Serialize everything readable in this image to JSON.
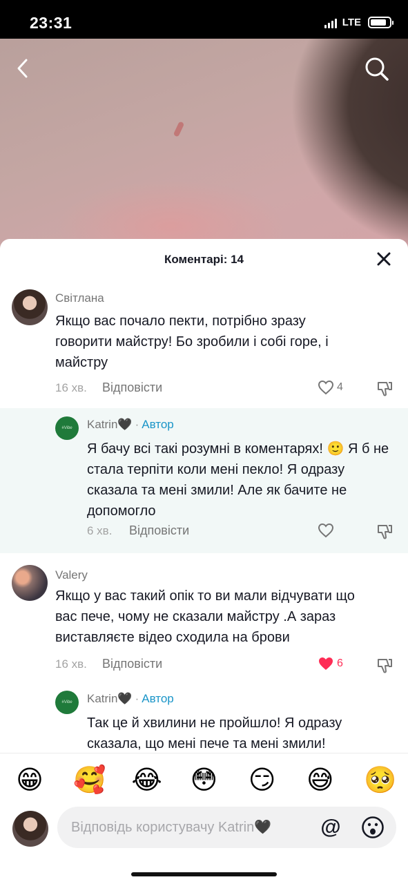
{
  "status_bar": {
    "time": "23:31",
    "network": "LTE",
    "icons": [
      "signal-icon",
      "battery-icon"
    ]
  },
  "video": {
    "nav": {
      "back_icon": "chevron-left-icon",
      "search_icon": "search-icon"
    }
  },
  "comments_sheet": {
    "title": "Коментарі: 14",
    "close_icon": "close-icon",
    "comments": [
      {
        "author": "Світлана",
        "text": "Якщо вас почало пекти, потрібно зразу говорити майстру! Бо зробили і собі горе, і майстру",
        "time": "16 хв.",
        "reply_label": "Відповісти",
        "likes": "4",
        "liked": false
      },
      {
        "author": "Katrin🖤",
        "badge": "Автор",
        "separator": "·",
        "text": "Я бачу всі такі розумні в коментарях! 🙂 Я б не стала терпіти коли мені пекло! Я одразу сказала та мені змили! Але як бачите не допомогло",
        "time": "6 хв.",
        "reply_label": "Відповісти",
        "liked": false
      },
      {
        "author": "Valery",
        "text": "Якщо у вас такий опік то ви мали відчувати що вас пече, чому не сказали майстру .А зараз виставляєте відео сходила на брови",
        "time": "16 хв.",
        "reply_label": "Відповісти",
        "likes": "6",
        "liked": true
      },
      {
        "author": "Katrin🖤",
        "badge": "Автор",
        "separator": "·",
        "text": "Так це й хвилини не пройшло! Я одразу сказала, що мені пече та мені змили!"
      }
    ],
    "emoji_bar": [
      "😁",
      "🥰",
      "😂",
      "😳",
      "😏",
      "😅",
      "🥺"
    ],
    "input": {
      "placeholder": "Відповідь користувачу Katrin🖤",
      "mention_label": "@",
      "emoji_icon": "emoji-face-icon"
    }
  },
  "colors": {
    "accent": "#fe2c55",
    "author_badge": "#1a95c8",
    "reply_bg": "#f2f8f7"
  }
}
